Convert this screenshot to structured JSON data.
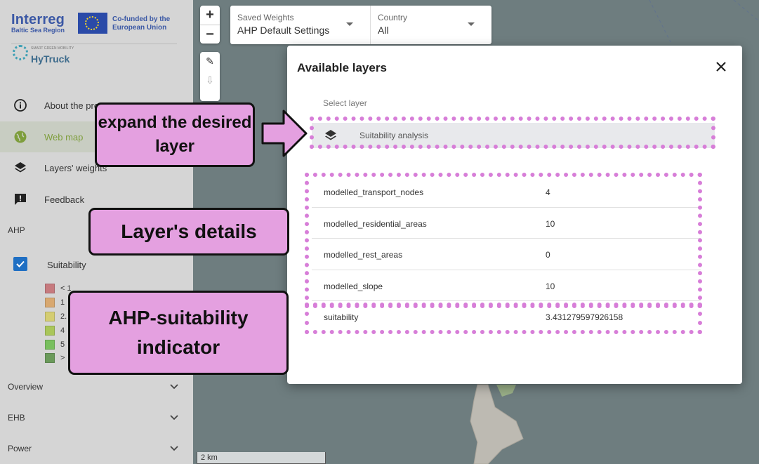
{
  "sidebar": {
    "logo": {
      "brand": "Interreg",
      "region": "Baltic Sea Region",
      "cofunded": "Co-funded by the European Union",
      "project_tagline": "SMART GREEN MOBILITY",
      "project": "HyTruck"
    },
    "nav": [
      {
        "label": "About the pro",
        "icon": "info-icon"
      },
      {
        "label": "Web map",
        "icon": "globe-icon",
        "active": true
      },
      {
        "label": "Layers' weights",
        "icon": "layers-icon"
      },
      {
        "label": "Feedback",
        "icon": "feedback-icon"
      }
    ],
    "ahp_heading": "AHP",
    "suitability_label": "Suitability",
    "suitability_checked": true,
    "legend": [
      {
        "label": "< 1",
        "color": "#c67a7e"
      },
      {
        "label": "1",
        "color": "#d8a870"
      },
      {
        "label": "2.",
        "color": "#d4cd72"
      },
      {
        "label": "4",
        "color": "#a9c65a"
      },
      {
        "label": "5",
        "color": "#78bf5e"
      },
      {
        "label": ">",
        "color": "#6a9a5a"
      }
    ],
    "accordions": [
      {
        "label": "Overview"
      },
      {
        "label": "EHB"
      },
      {
        "label": "Power"
      }
    ]
  },
  "map": {
    "zoom_in": "+",
    "zoom_out": "−",
    "scale": "2 km",
    "filters": [
      {
        "label": "Saved Weights",
        "value": "AHP Default Settings"
      },
      {
        "label": "Country",
        "value": "All"
      }
    ]
  },
  "modal": {
    "title": "Available layers",
    "select_label": "Select layer",
    "layer_name": "Suitability analysis",
    "rows": [
      {
        "key": "modelled_transport_nodes",
        "value": "4"
      },
      {
        "key": "modelled_residential_areas",
        "value": "10"
      },
      {
        "key": "modelled_rest_areas",
        "value": "0"
      },
      {
        "key": "modelled_slope",
        "value": "10"
      },
      {
        "key": "suitability",
        "value": "3.431279597926158"
      }
    ]
  },
  "annotations": {
    "expand": "expand the desired layer",
    "details": "Layer's details",
    "indicator": "AHP-suitability indicator"
  },
  "colors": {
    "annotation_fill": "#e4a0e0",
    "annotation_dots": "#d77ed8",
    "active_nav": "#7e9e3c",
    "checkbox": "#1f6fc3"
  }
}
